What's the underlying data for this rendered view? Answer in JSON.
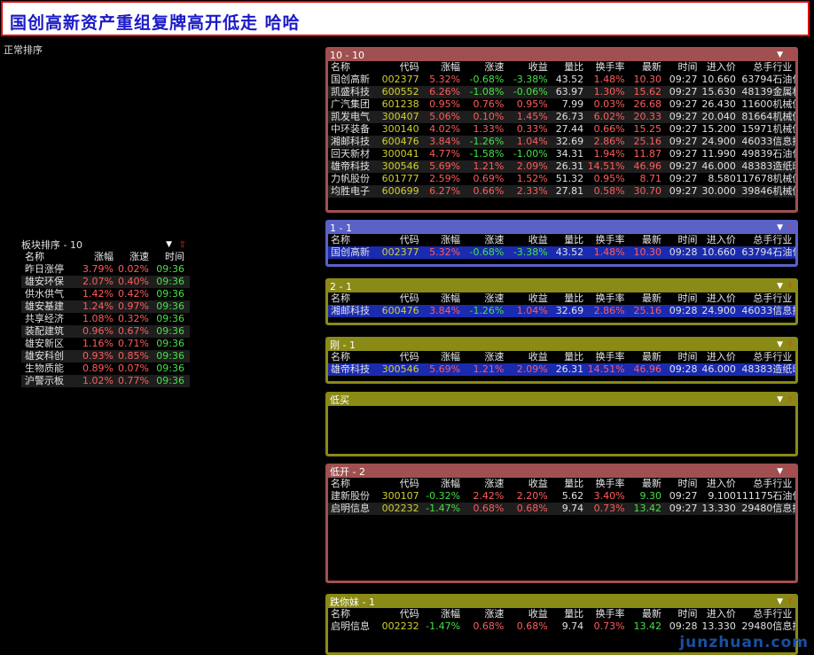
{
  "banner": {
    "text": "国创高新资产重组复牌高开低走 哈哈"
  },
  "mode_label": "正常排序",
  "columns": [
    "名称",
    "代码",
    "涨幅",
    "涨速",
    "收益",
    "量比",
    "换手率",
    "最新",
    "时间",
    "进入价",
    "总手",
    "行业"
  ],
  "panels": [
    {
      "title": "10 - 10",
      "color": "red",
      "rows": [
        {
          "name": "国创高新",
          "code": "002377",
          "chg": "5.32%",
          "speed": "-0.68%",
          "ret": "-3.38%",
          "vr": "43.52",
          "turn": "1.48%",
          "last": "10.30",
          "time": "09:27",
          "entry": "10.660",
          "vol": "63794",
          "ind": "石油化工",
          "chg_c": "r",
          "speed_c": "g",
          "ret_c": "g",
          "turn_c": "r",
          "last_c": "r"
        },
        {
          "name": "凯盛科技",
          "code": "600552",
          "chg": "6.26%",
          "speed": "-1.08%",
          "ret": "-0.06%",
          "vr": "63.97",
          "turn": "1.30%",
          "last": "15.62",
          "time": "09:27",
          "entry": "15.630",
          "vol": "48139",
          "ind": "金属材料",
          "chg_c": "r",
          "speed_c": "g",
          "ret_c": "g",
          "turn_c": "r",
          "last_c": "r"
        },
        {
          "name": "广汽集团",
          "code": "601238",
          "chg": "0.95%",
          "speed": "0.76%",
          "ret": "0.95%",
          "vr": "7.99",
          "turn": "0.03%",
          "last": "26.68",
          "time": "09:27",
          "entry": "26.430",
          "vol": "11600",
          "ind": "机械仪表",
          "chg_c": "r",
          "speed_c": "r",
          "ret_c": "r",
          "turn_c": "r",
          "last_c": "r"
        },
        {
          "name": "凯发电气",
          "code": "300407",
          "chg": "5.06%",
          "speed": "0.10%",
          "ret": "1.45%",
          "vr": "26.73",
          "turn": "6.02%",
          "last": "20.33",
          "time": "09:27",
          "entry": "20.040",
          "vol": "81664",
          "ind": "机械仪表",
          "chg_c": "r",
          "speed_c": "r",
          "ret_c": "r",
          "turn_c": "r",
          "last_c": "r"
        },
        {
          "name": "中环装备",
          "code": "300140",
          "chg": "4.02%",
          "speed": "1.33%",
          "ret": "0.33%",
          "vr": "27.44",
          "turn": "0.66%",
          "last": "15.25",
          "time": "09:27",
          "entry": "15.200",
          "vol": "15971",
          "ind": "机械仪表",
          "chg_c": "r",
          "speed_c": "r",
          "ret_c": "r",
          "turn_c": "r",
          "last_c": "r"
        },
        {
          "name": "湘邮科技",
          "code": "600476",
          "chg": "3.84%",
          "speed": "-1.26%",
          "ret": "1.04%",
          "vr": "32.69",
          "turn": "2.86%",
          "last": "25.16",
          "time": "09:27",
          "entry": "24.900",
          "vol": "46033",
          "ind": "信息技术",
          "chg_c": "r",
          "speed_c": "g",
          "ret_c": "r",
          "turn_c": "r",
          "last_c": "r"
        },
        {
          "name": "回天新材",
          "code": "300041",
          "chg": "4.77%",
          "speed": "-1.58%",
          "ret": "-1.00%",
          "vr": "34.31",
          "turn": "1.94%",
          "last": "11.87",
          "time": "09:27",
          "entry": "11.990",
          "vol": "49839",
          "ind": "石油化工",
          "chg_c": "r",
          "speed_c": "g",
          "ret_c": "g",
          "turn_c": "r",
          "last_c": "r"
        },
        {
          "name": "雄帝科技",
          "code": "300546",
          "chg": "5.69%",
          "speed": "1.21%",
          "ret": "2.09%",
          "vr": "26.31",
          "turn": "14.51%",
          "last": "46.96",
          "time": "09:27",
          "entry": "46.000",
          "vol": "48383",
          "ind": "造纸印刷",
          "chg_c": "r",
          "speed_c": "r",
          "ret_c": "r",
          "turn_c": "r",
          "last_c": "r"
        },
        {
          "name": "力帆股份",
          "code": "601777",
          "chg": "2.59%",
          "speed": "0.69%",
          "ret": "1.52%",
          "vr": "51.32",
          "turn": "0.95%",
          "last": "8.71",
          "time": "09:27",
          "entry": "8.580",
          "vol": "117678",
          "ind": "机械仪表",
          "chg_c": "r",
          "speed_c": "r",
          "ret_c": "r",
          "turn_c": "r",
          "last_c": "r"
        },
        {
          "name": "均胜电子",
          "code": "600699",
          "chg": "6.27%",
          "speed": "0.66%",
          "ret": "2.33%",
          "vr": "27.81",
          "turn": "0.58%",
          "last": "30.70",
          "time": "09:27",
          "entry": "30.000",
          "vol": "39846",
          "ind": "机械仪表",
          "chg_c": "r",
          "speed_c": "r",
          "ret_c": "r",
          "turn_c": "r",
          "last_c": "r"
        }
      ]
    },
    {
      "title": "1 - 1",
      "color": "blue",
      "rows": [
        {
          "name": "国创高新",
          "code": "002377",
          "chg": "5.32%",
          "speed": "-0.68%",
          "ret": "-3.38%",
          "vr": "43.52",
          "turn": "1.48%",
          "last": "10.30",
          "time": "09:28",
          "entry": "10.660",
          "vol": "63794",
          "ind": "石油化工",
          "chg_c": "r",
          "speed_c": "g",
          "ret_c": "g",
          "turn_c": "r",
          "last_c": "r",
          "sel": true
        }
      ]
    },
    {
      "title": "2 - 1",
      "color": "olive",
      "rows": [
        {
          "name": "湘邮科技",
          "code": "600476",
          "chg": "3.84%",
          "speed": "-1.26%",
          "ret": "1.04%",
          "vr": "32.69",
          "turn": "2.86%",
          "last": "25.16",
          "time": "09:28",
          "entry": "24.900",
          "vol": "46033",
          "ind": "信息技术",
          "chg_c": "r",
          "speed_c": "g",
          "ret_c": "r",
          "turn_c": "r",
          "last_c": "r",
          "sel": true
        }
      ]
    },
    {
      "title": "刚 - 1",
      "color": "olive",
      "rows": [
        {
          "name": "雄帝科技",
          "code": "300546",
          "chg": "5.69%",
          "speed": "1.21%",
          "ret": "2.09%",
          "vr": "26.31",
          "turn": "14.51%",
          "last": "46.96",
          "time": "09:28",
          "entry": "46.000",
          "vol": "48383",
          "ind": "造纸印刷",
          "chg_c": "r",
          "speed_c": "r",
          "ret_c": "r",
          "turn_c": "r",
          "last_c": "r",
          "sel": true
        }
      ]
    },
    {
      "title": "低买",
      "color": "olive",
      "rows": []
    },
    {
      "title": "低开 - 2",
      "color": "red",
      "rows": [
        {
          "name": "建新股份",
          "code": "300107",
          "chg": "-0.32%",
          "speed": "2.42%",
          "ret": "2.20%",
          "vr": "5.62",
          "turn": "3.40%",
          "last": "9.30",
          "time": "09:27",
          "entry": "9.100",
          "vol": "111175",
          "ind": "石油化工",
          "chg_c": "g",
          "speed_c": "r",
          "ret_c": "r",
          "turn_c": "r",
          "last_c": "g"
        },
        {
          "name": "启明信息",
          "code": "002232",
          "chg": "-1.47%",
          "speed": "0.68%",
          "ret": "0.68%",
          "vr": "9.74",
          "turn": "0.73%",
          "last": "13.42",
          "time": "09:27",
          "entry": "13.330",
          "vol": "29480",
          "ind": "信息技术",
          "chg_c": "g",
          "speed_c": "r",
          "ret_c": "r",
          "turn_c": "r",
          "last_c": "g"
        }
      ]
    },
    {
      "title": "跌你妹 - 1",
      "color": "olive",
      "rows": [
        {
          "name": "启明信息",
          "code": "002232",
          "chg": "-1.47%",
          "speed": "0.68%",
          "ret": "0.68%",
          "vr": "9.74",
          "turn": "0.73%",
          "last": "13.42",
          "time": "09:28",
          "entry": "13.330",
          "vol": "29480",
          "ind": "信息技术",
          "chg_c": "g",
          "speed_c": "r",
          "ret_c": "r",
          "turn_c": "r",
          "last_c": "g"
        }
      ]
    }
  ],
  "sector": {
    "title": "板块排序 - 10",
    "columns": [
      "名称",
      "涨幅",
      "涨速",
      "时间"
    ],
    "rows": [
      {
        "name": "昨日涨停",
        "chg": "3.79%",
        "speed": "0.02%",
        "time": "09:36"
      },
      {
        "name": "雄安环保",
        "chg": "2.07%",
        "speed": "0.40%",
        "time": "09:36"
      },
      {
        "name": "供水供气",
        "chg": "1.42%",
        "speed": "0.42%",
        "time": "09:36"
      },
      {
        "name": "雄安基建",
        "chg": "1.24%",
        "speed": "0.97%",
        "time": "09:36"
      },
      {
        "name": "共享经济",
        "chg": "1.08%",
        "speed": "0.32%",
        "time": "09:36"
      },
      {
        "name": "装配建筑",
        "chg": "0.96%",
        "speed": "0.67%",
        "time": "09:36"
      },
      {
        "name": "雄安新区",
        "chg": "1.16%",
        "speed": "0.71%",
        "time": "09:36"
      },
      {
        "name": "雄安科创",
        "chg": "0.93%",
        "speed": "0.85%",
        "time": "09:36"
      },
      {
        "name": "生物质能",
        "chg": "0.89%",
        "speed": "0.07%",
        "time": "09:36"
      },
      {
        "name": "沪警示板",
        "chg": "1.02%",
        "speed": "0.77%",
        "time": "09:36"
      }
    ]
  },
  "icons": {
    "dropdown": "dropdown-triangle-icon",
    "up": "red-up-arrow-icon"
  },
  "watermark": "junzhuan.com"
}
